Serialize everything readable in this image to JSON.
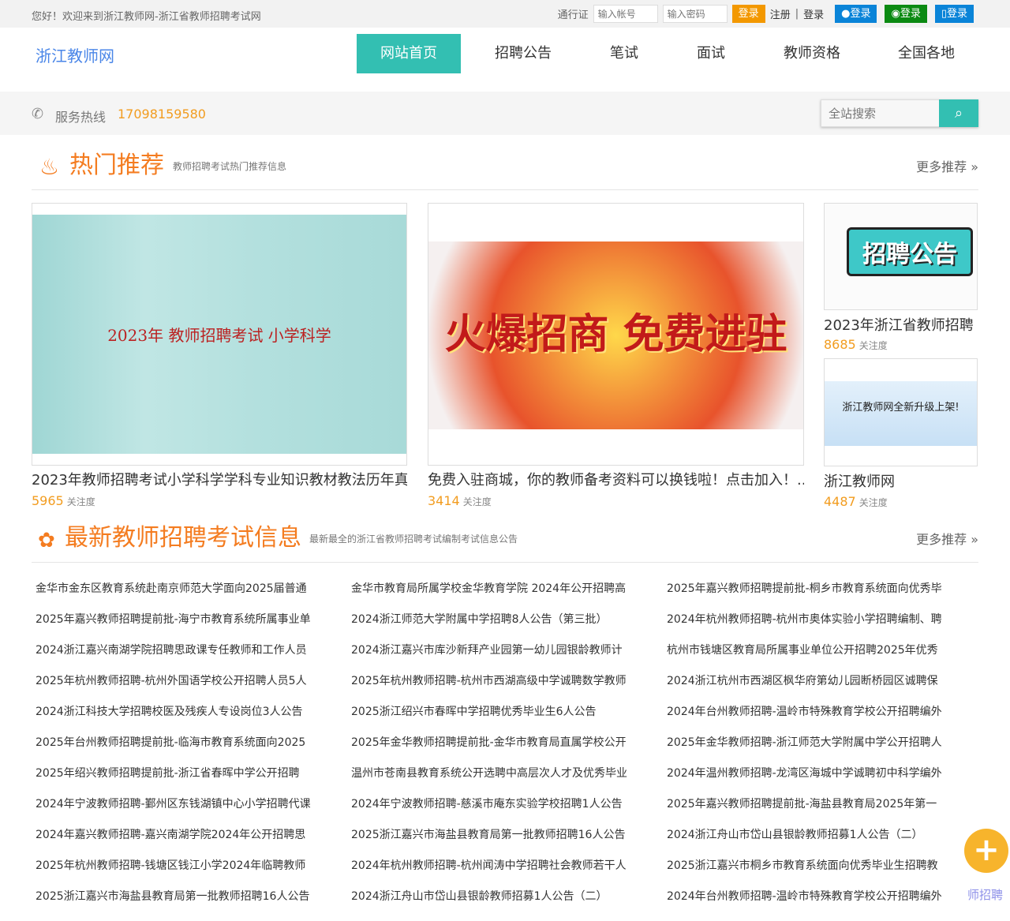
{
  "topbar": {
    "welcome": "您好！欢迎来到浙江教师网-浙江省教师招聘考试网",
    "passport": "通行证",
    "account_placeholder": "输入帐号",
    "password_placeholder": "输入密码",
    "login": "登录",
    "register": "注册",
    "sep": "|",
    "login2": "登录",
    "qq_login": "登录",
    "wechat_login": "登录",
    "other_login": "登录",
    "colors": {
      "login": "#f39800",
      "qq": "#0a84d8",
      "wechat": "#0b8a12"
    }
  },
  "header": {
    "logo": "浙江教师网",
    "nav": [
      "网站首页",
      "招聘公告",
      "笔试",
      "面试",
      "教师资格",
      "全国各地"
    ]
  },
  "service": {
    "label": "服务热线",
    "phone": "17098159580",
    "search_placeholder": "全站搜索"
  },
  "hot": {
    "title": "热门推荐",
    "subtitle": "教师招聘考试热门推荐信息",
    "more": "更多推荐 »",
    "cards": [
      {
        "title": "2023年教师招聘考试小学科学学科专业知识教材教法历年真",
        "count": "5965",
        "count_label": "关注度",
        "image_text": "2023年 教师招聘考试 小学科学"
      },
      {
        "title": "免费入驻商城，你的教师备考资料可以换钱啦！点击加入！..",
        "count": "3414",
        "count_label": "关注度",
        "image_text": "火爆招商 免费进驻"
      },
      {
        "title": "2023年浙江省教师招聘",
        "count": "8685",
        "count_label": "关注度",
        "image_text": "招聘公告"
      },
      {
        "title": "浙江教师网",
        "count": "4487",
        "count_label": "关注度",
        "image_text": "浙江教师网全新升级上架!"
      }
    ]
  },
  "latest": {
    "title": "最新教师招聘考试信息",
    "subtitle": "最新最全的浙江省教师招聘考试编制考试信息公告",
    "more": "更多推荐 »",
    "items": [
      "金华市金东区教育系统赴南京师范大学面向2025届普通",
      "金华市教育局所属学校金华教育学院 2024年公开招聘高",
      "2025年嘉兴教师招聘提前批-桐乡市教育系统面向优秀毕",
      "2025年嘉兴教师招聘提前批-海宁市教育系统所属事业单",
      "2024浙江师范大学附属中学招聘8人公告（第三批）",
      "2024年杭州教师招聘-杭州市奥体实验小学招聘编制、聘",
      "2024浙江嘉兴南湖学院招聘思政课专任教师和工作人员",
      "2024浙江嘉兴市库沙新拜产业园第一幼儿园银龄教师计",
      "杭州市钱塘区教育局所属事业单位公开招聘2025年优秀",
      "2025年杭州教师招聘-杭州外国语学校公开招聘人员5人",
      "2025年杭州教师招聘-杭州市西湖高级中学诚聘数学教师",
      "2024浙江杭州市西湖区枫华府第幼儿园断桥园区诚聘保",
      "2024浙江科技大学招聘校医及残疾人专设岗位3人公告",
      "2025浙江绍兴市春晖中学招聘优秀毕业生6人公告",
      "2024年台州教师招聘-温岭市特殊教育学校公开招聘编外",
      "2025年台州教师招聘提前批-临海市教育系统面向2025",
      "2025年金华教师招聘提前批-金华市教育局直属学校公开",
      "2025年金华教师招聘-浙江师范大学附属中学公开招聘人",
      "2025年绍兴教师招聘提前批-浙江省春晖中学公开招聘",
      "温州市苍南县教育系统公开选聘中高层次人才及优秀毕业",
      "2024年温州教师招聘-龙湾区海城中学诚聘初中科学编外",
      "2024年宁波教师招聘-鄞州区东钱湖镇中心小学招聘代课",
      "2024年宁波教师招聘-慈溪市庵东实验学校招聘1人公告",
      "2025年嘉兴教师招聘提前批-海盐县教育局2025年第一",
      "2024年嘉兴教师招聘-嘉兴南湖学院2024年公开招聘思",
      "2025浙江嘉兴市海盐县教育局第一批教师招聘16人公告",
      "2024浙江舟山市岱山县银龄教师招募1人公告（二）",
      "2025年杭州教师招聘-钱塘区钱江小学2024年临聘教师",
      "2024年杭州教师招聘-杭州闻涛中学招聘社会教师若干人",
      "2025浙江嘉兴市桐乡市教育系统面向优秀毕业生招聘教",
      "2025浙江嘉兴市海盐县教育局第一批教师招聘16人公告",
      "2024浙江舟山市岱山县银龄教师招募1人公告（二）",
      "2024年台州教师招聘-温岭市特殊教育学校公开招聘编外"
    ]
  },
  "float": {
    "label": "师招聘"
  }
}
